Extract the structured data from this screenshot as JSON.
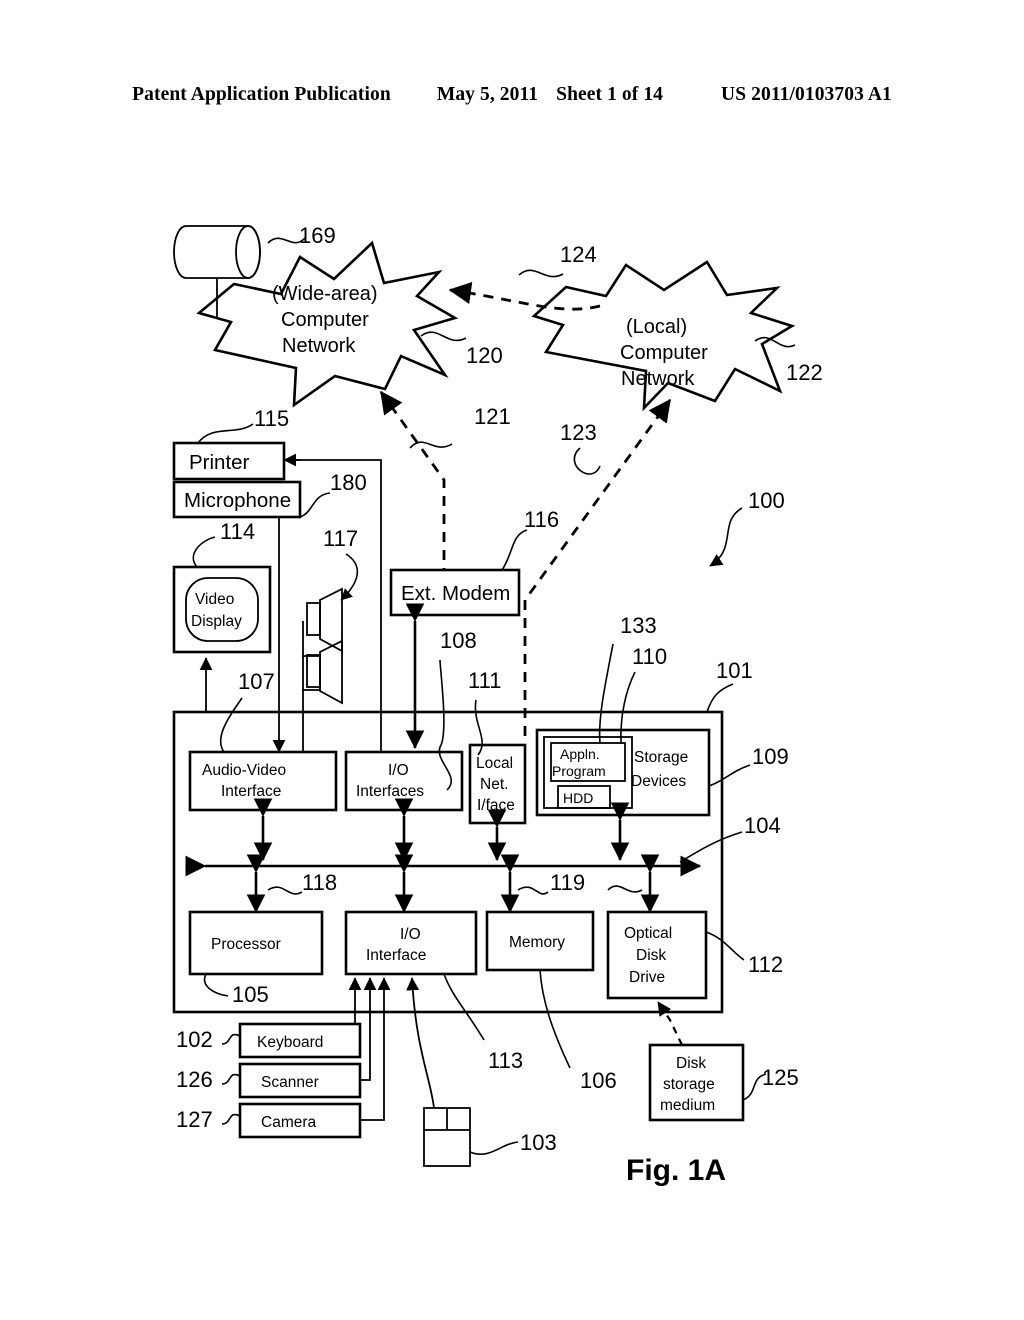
{
  "header": {
    "publication": "Patent Application Publication",
    "date": "May 5, 2011",
    "sheet": "Sheet 1 of 14",
    "patent_number": "US 2011/0103703 A1"
  },
  "figure": {
    "caption": "Fig. 1A",
    "nodes": {
      "wide_area_network": {
        "line1": "(Wide-area)",
        "line2": "Computer",
        "line3": "Network",
        "ref": "120"
      },
      "local_network": {
        "line1": "(Local)",
        "line2": "Computer",
        "line3": "Network",
        "ref": "122"
      },
      "satellite_dish": {
        "label": "",
        "ref": "169"
      },
      "printer": {
        "label": "Printer",
        "ref": "115"
      },
      "microphone": {
        "label": "Microphone",
        "ref": "180"
      },
      "video_display": {
        "line1": "Video",
        "line2": "Display",
        "ref": "114"
      },
      "loudspeakers": {
        "label": "",
        "ref": "117"
      },
      "ext_modem": {
        "label": "Ext. Modem",
        "ref": "116"
      },
      "audio_video_interface": {
        "line1": "Audio-Video",
        "line2": "Interface",
        "ref": "107"
      },
      "io_interfaces": {
        "line1": "I/O",
        "line2": "Interfaces",
        "ref": "108"
      },
      "local_net_iface": {
        "line1": "Local",
        "line2": "Net.",
        "line3": "I/face",
        "ref": "111"
      },
      "storage_devices": {
        "line1": "Storage",
        "line2": "Devices",
        "ref": "109"
      },
      "appln_program": {
        "line1": "Appln.",
        "line2": "Program",
        "ref": "133"
      },
      "hdd": {
        "label": "HDD",
        "ref": "110"
      },
      "processor": {
        "label": "Processor",
        "ref": "105"
      },
      "io_interface": {
        "line1": "I/O",
        "line2": "Interface",
        "ref": "113"
      },
      "memory": {
        "label": "Memory",
        "ref": "106"
      },
      "optical_disk_drive": {
        "line1": "Optical",
        "line2": "Disk",
        "line3": "Drive",
        "ref": "112"
      },
      "keyboard": {
        "label": "Keyboard",
        "ref": "102"
      },
      "scanner": {
        "label": "Scanner",
        "ref": "126"
      },
      "camera": {
        "label": "Camera",
        "ref": "127"
      },
      "mouse": {
        "label": "",
        "ref": "103"
      },
      "disk_storage_medium": {
        "line1": "Disk",
        "line2": "storage",
        "line3": "medium",
        "ref": "125"
      },
      "computer_module": {
        "label": "",
        "ref": "101"
      },
      "system_bus": {
        "label": "",
        "ref": "104"
      },
      "overall_system": {
        "label": "",
        "ref": "100"
      }
    },
    "connector_refs": {
      "wan_to_lan_link": "124",
      "modem_to_wan_link": "121",
      "lan_to_localnet_link": "123",
      "bus_ref_left": "118",
      "bus_ref_right": "119"
    },
    "reference_numerals": [
      "100",
      "101",
      "102",
      "103",
      "104",
      "105",
      "106",
      "107",
      "108",
      "109",
      "110",
      "111",
      "112",
      "113",
      "114",
      "115",
      "116",
      "117",
      "118",
      "119",
      "120",
      "121",
      "122",
      "123",
      "124",
      "125",
      "126",
      "127",
      "133",
      "169",
      "180"
    ]
  }
}
